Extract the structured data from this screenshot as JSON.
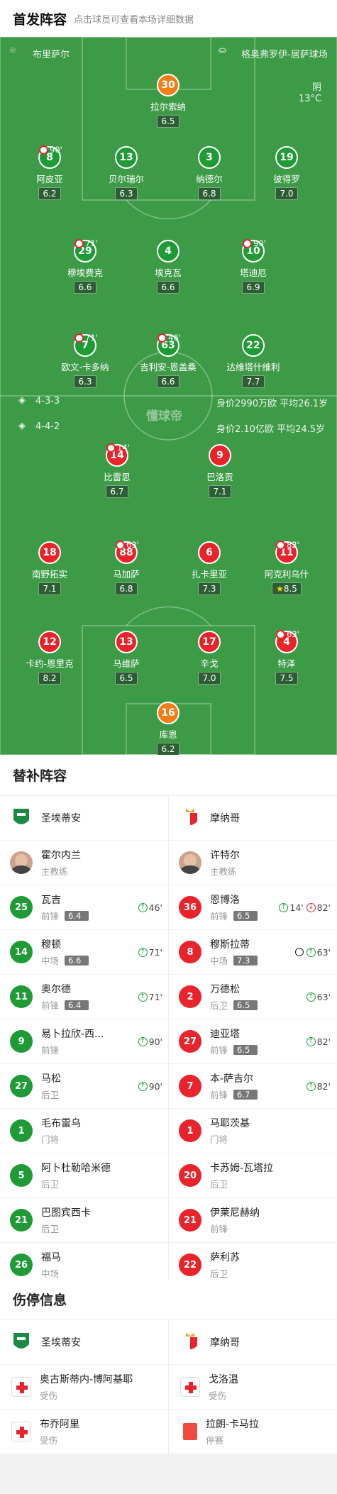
{
  "header": {
    "title": "首发阵容",
    "subtitle": "点击球员可查看本场详细数据"
  },
  "pitch": {
    "home_team": "布里萨尔",
    "away_team": "格奥弗罗伊-居萨球场",
    "weather": "阴",
    "temp": "13°C",
    "watermark": "懂球帝",
    "home_form": "4-3-3",
    "home_stats": "身价2990万欧  平均26.1岁",
    "away_form": "4-4-2",
    "away_stats": "身价2.10亿欧  平均24.5岁"
  },
  "players": [
    {
      "num": "30",
      "name": "拉尔索纳",
      "rating": "6.5",
      "color": "o",
      "captain": true
    },
    {
      "num": "8",
      "name": "阿皮亚",
      "rating": "6.2",
      "color": "g",
      "sub": "90'"
    },
    {
      "num": "13",
      "name": "贝尔瑞尔",
      "rating": "6.3",
      "color": "g"
    },
    {
      "num": "3",
      "name": "纳德尔",
      "rating": "6.8",
      "color": "g"
    },
    {
      "num": "19",
      "name": "彼得罗",
      "rating": "7.0",
      "color": "g"
    },
    {
      "num": "29",
      "name": "穆埃费克",
      "rating": "6.6",
      "color": "g",
      "sub": "71'"
    },
    {
      "num": "4",
      "name": "埃克瓦",
      "rating": "6.6",
      "color": "g"
    },
    {
      "num": "10",
      "name": "塔迪厄",
      "rating": "6.9",
      "color": "g",
      "sub": "90'"
    },
    {
      "num": "7",
      "name": "欧文-卡多纳",
      "rating": "6.3",
      "color": "g",
      "sub": "71'"
    },
    {
      "num": "63",
      "name": "吉利安-恩盖桑",
      "rating": "6.6",
      "color": "g",
      "sub": "46'"
    },
    {
      "num": "22",
      "name": "达维塔什维利",
      "rating": "7.7",
      "color": "g"
    },
    {
      "num": "14",
      "name": "比雷思",
      "rating": "6.7",
      "color": "r",
      "sub": "14'"
    },
    {
      "num": "9",
      "name": "巴洛贡",
      "rating": "7.1",
      "color": "r"
    },
    {
      "num": "18",
      "name": "南野拓实",
      "rating": "7.1",
      "color": "r"
    },
    {
      "num": "88",
      "name": "马加萨",
      "rating": "6.8",
      "color": "r",
      "sub": "63'"
    },
    {
      "num": "6",
      "name": "扎卡里亚",
      "rating": "7.3",
      "color": "r",
      "captain": true
    },
    {
      "num": "11",
      "name": "阿克利乌什",
      "rating": "8.5",
      "color": "r",
      "sub": "82'",
      "star": true
    },
    {
      "num": "12",
      "name": "卡约-恩里克",
      "rating": "8.2",
      "color": "r"
    },
    {
      "num": "13",
      "name": "马维萨",
      "rating": "6.5",
      "color": "r"
    },
    {
      "num": "17",
      "name": "辛戈",
      "rating": "7.0",
      "color": "r"
    },
    {
      "num": "4",
      "name": "特泽",
      "rating": "7.5",
      "color": "r",
      "sub": "63'"
    },
    {
      "num": "16",
      "name": "库恩",
      "rating": "6.2",
      "color": "o"
    }
  ],
  "subs": {
    "title": "替补阵容",
    "home_team": "圣埃蒂安",
    "away_team": "摩纳哥",
    "home_coach": {
      "name": "霍尔内兰",
      "role": "主教练"
    },
    "away_coach": {
      "name": "许特尔",
      "role": "主教练"
    },
    "home": [
      {
        "num": "25",
        "name": "瓦吉",
        "pos": "前锋",
        "rating": "6.4",
        "in": "46'"
      },
      {
        "num": "14",
        "name": "穆顿",
        "pos": "中场",
        "rating": "6.6",
        "in": "71'"
      },
      {
        "num": "11",
        "name": "奥尔德",
        "pos": "前锋",
        "rating": "6.4",
        "in": "71'"
      },
      {
        "num": "9",
        "name": "易卜拉欣-西...",
        "pos": "前锋",
        "rating": "",
        "in": "90'"
      },
      {
        "num": "27",
        "name": "马松",
        "pos": "后卫",
        "rating": "",
        "in": "90'"
      },
      {
        "num": "1",
        "name": "毛布雷乌",
        "pos": "门将",
        "rating": "",
        "in": ""
      },
      {
        "num": "5",
        "name": "阿卜杜勒哈米德",
        "pos": "后卫",
        "rating": "",
        "in": ""
      },
      {
        "num": "21",
        "name": "巴图宾西卡",
        "pos": "后卫",
        "rating": "",
        "in": ""
      },
      {
        "num": "26",
        "name": "福马",
        "pos": "中场",
        "rating": "",
        "in": ""
      }
    ],
    "away": [
      {
        "num": "36",
        "name": "恩博洛",
        "pos": "前锋",
        "rating": "6.5",
        "in": "14'",
        "out": "82'"
      },
      {
        "num": "8",
        "name": "穆斯拉蒂",
        "pos": "中场",
        "rating": "7.3",
        "in": "63'",
        "goal": true
      },
      {
        "num": "2",
        "name": "万德松",
        "pos": "后卫",
        "rating": "6.5",
        "in": "63'"
      },
      {
        "num": "27",
        "name": "迪亚塔",
        "pos": "前锋",
        "rating": "6.5",
        "in": "82'"
      },
      {
        "num": "7",
        "name": "本-萨吉尔",
        "pos": "前锋",
        "rating": "6.7",
        "in": "82'"
      },
      {
        "num": "1",
        "name": "马耶茨基",
        "pos": "门将",
        "rating": "",
        "in": ""
      },
      {
        "num": "20",
        "name": "卡苏姆-瓦塔拉",
        "pos": "后卫",
        "rating": "",
        "in": ""
      },
      {
        "num": "21",
        "name": "伊莱尼赫纳",
        "pos": "前锋",
        "rating": "",
        "in": ""
      },
      {
        "num": "22",
        "name": "萨利苏",
        "pos": "后卫",
        "rating": "",
        "in": ""
      }
    ]
  },
  "injury": {
    "title": "伤停信息",
    "home_team": "圣埃蒂安",
    "away_team": "摩纳哥",
    "home": [
      {
        "name": "奥古斯蒂内-博阿基耶",
        "status": "受伤"
      },
      {
        "name": "布乔阿里",
        "status": "受伤"
      }
    ],
    "away": [
      {
        "name": "戈洛温",
        "status": "受伤"
      },
      {
        "name": "拉朗-卡马拉",
        "status": "停赛"
      }
    ]
  }
}
